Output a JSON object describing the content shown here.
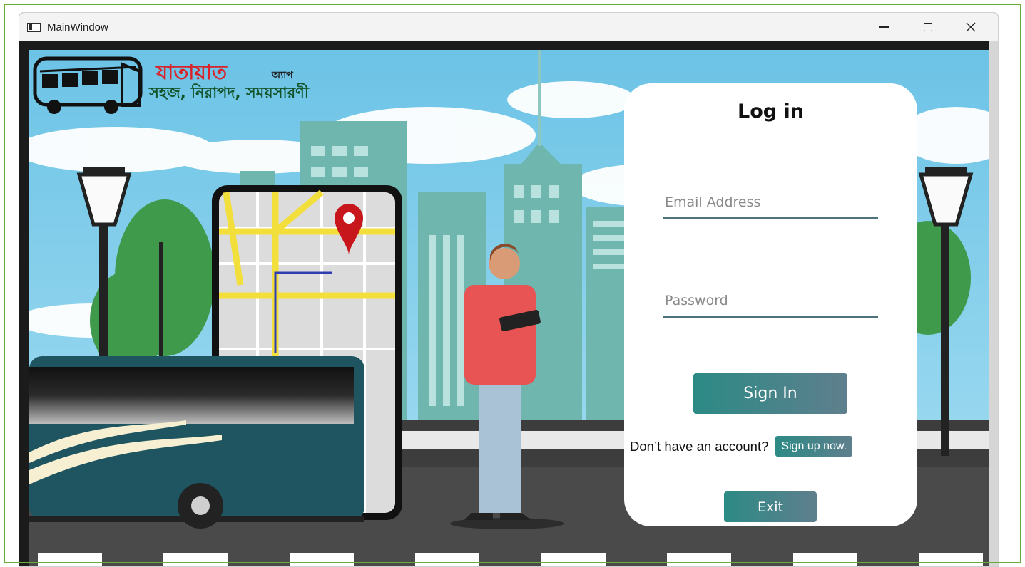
{
  "window": {
    "title": "MainWindow",
    "controls": {
      "minimize": "minimize",
      "maximize": "maximize",
      "close": "close"
    }
  },
  "brand": {
    "title": "যাতায়াত",
    "subtitle": "অ্যাপ",
    "tagline": "সহজ, নিরাপদ, সময়সারণী",
    "colors": {
      "title": "#d8232a",
      "tagline": "#14542a"
    }
  },
  "login": {
    "heading": "Log in",
    "email": {
      "placeholder": "Email Address",
      "value": ""
    },
    "password": {
      "placeholder": "Password",
      "value": ""
    },
    "sign_in_label": "Sign In",
    "no_account_text": "Don’t have an account?",
    "sign_up_label": "Sign up now.",
    "exit_label": "Exit"
  },
  "theme": {
    "button_gradient": [
      "#2c8a85",
      "#5f7f8d"
    ],
    "field_underline": "#4e737a",
    "sky": "#7fcde8"
  }
}
